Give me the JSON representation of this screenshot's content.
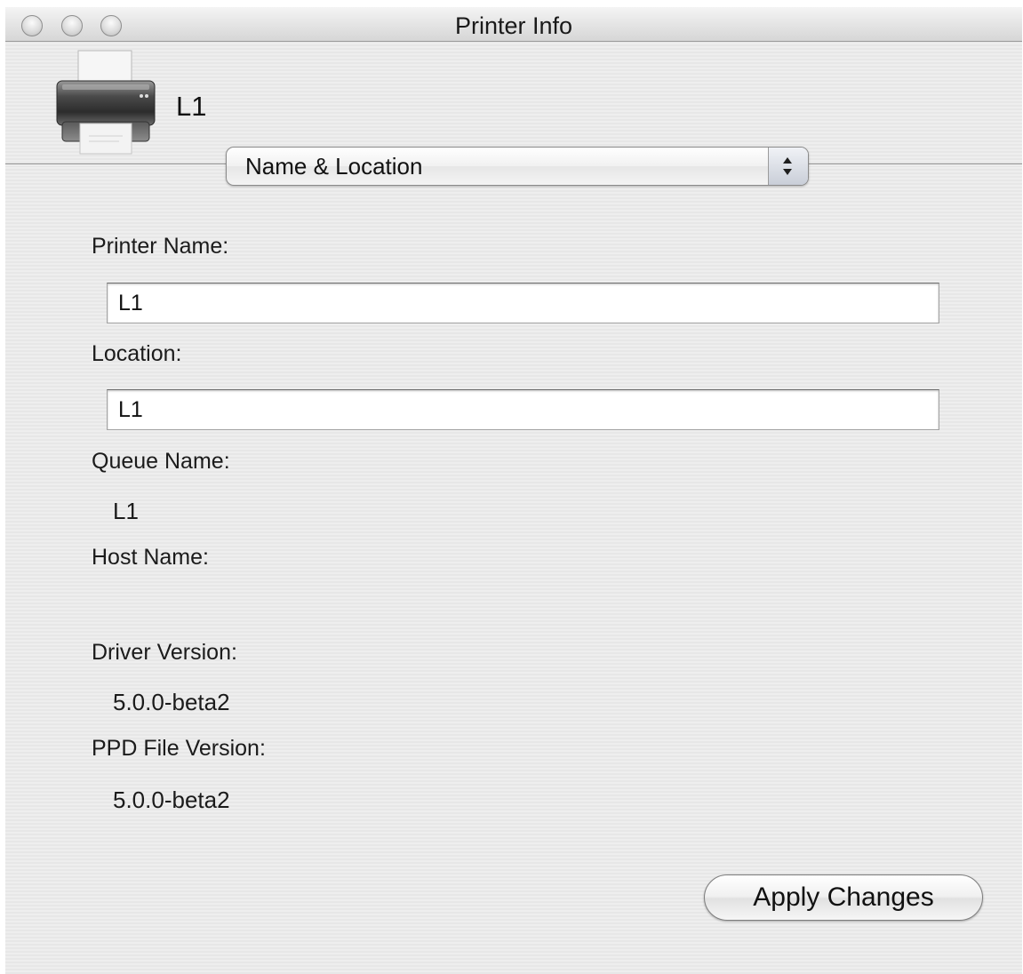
{
  "window": {
    "title": "Printer Info"
  },
  "header": {
    "printer_name": "L1",
    "printer_icon": "printer-icon"
  },
  "panel_selector": {
    "selected": "Name & Location"
  },
  "fields": {
    "printer_name_label": "Printer Name:",
    "printer_name_value": "L1",
    "location_label": "Location:",
    "location_value": "L1",
    "queue_name_label": "Queue Name:",
    "queue_name_value": "L1",
    "host_name_label": "Host Name:",
    "host_name_value": "",
    "driver_version_label": "Driver Version:",
    "driver_version_value": "5.0.0-beta2",
    "ppd_file_version_label": "PPD File Version:",
    "ppd_file_version_value": "5.0.0-beta2"
  },
  "actions": {
    "apply_label": "Apply Changes"
  }
}
